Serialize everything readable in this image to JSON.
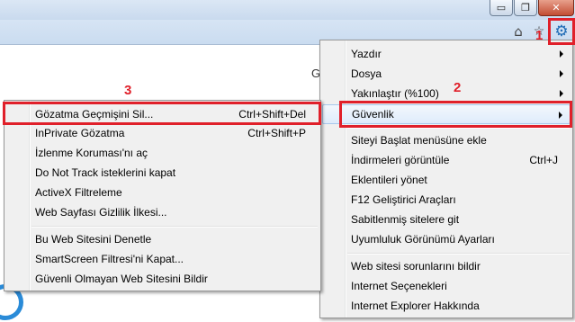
{
  "window": {
    "minimize_glyph": "▭",
    "restore_glyph": "❐",
    "close_glyph": "✕"
  },
  "toolbar": {
    "home_icon": "⌂",
    "favorites_icon": "☆",
    "tools_icon": "⚙"
  },
  "page": {
    "partial_text": "G"
  },
  "annotations": {
    "step1": "1",
    "step2": "2",
    "step3": "3",
    "color": "#e0202a"
  },
  "tools_menu": {
    "items": [
      {
        "label": "Yazdır",
        "shortcut": "",
        "submenu": true
      },
      {
        "label": "Dosya",
        "shortcut": "",
        "submenu": true
      },
      {
        "label": "Yakınlaştır (%100)",
        "shortcut": "",
        "submenu": true
      },
      {
        "label": "Güvenlik",
        "shortcut": "",
        "submenu": true
      },
      {
        "label": "Siteyi Başlat menüsüne ekle",
        "shortcut": "",
        "submenu": false
      },
      {
        "label": "İndirmeleri görüntüle",
        "shortcut": "Ctrl+J",
        "submenu": false
      },
      {
        "label": "Eklentileri yönet",
        "shortcut": "",
        "submenu": false
      },
      {
        "label": "F12 Geliştirici Araçları",
        "shortcut": "",
        "submenu": false
      },
      {
        "label": "Sabitlenmiş sitelere git",
        "shortcut": "",
        "submenu": false
      },
      {
        "label": "Uyumluluk Görünümü Ayarları",
        "shortcut": "",
        "submenu": false
      },
      {
        "label": "Web sitesi sorunlarını bildir",
        "shortcut": "",
        "submenu": false
      },
      {
        "label": "Internet Seçenekleri",
        "shortcut": "",
        "submenu": false
      },
      {
        "label": "Internet Explorer Hakkında",
        "shortcut": "",
        "submenu": false
      }
    ]
  },
  "security_menu": {
    "items": [
      {
        "label": "Gözatma Geçmişini Sil...",
        "shortcut": "Ctrl+Shift+Del"
      },
      {
        "label": "InPrivate Gözatma",
        "shortcut": "Ctrl+Shift+P"
      },
      {
        "label": "İzlenme Koruması'nı aç",
        "shortcut": ""
      },
      {
        "label": "Do Not Track isteklerini kapat",
        "shortcut": ""
      },
      {
        "label": "ActiveX Filtreleme",
        "shortcut": ""
      },
      {
        "label": "Web Sayfası Gizlilik İlkesi...",
        "shortcut": ""
      },
      {
        "label": "Bu Web Sitesini Denetle",
        "shortcut": ""
      },
      {
        "label": "SmartScreen Filtresi'ni Kapat...",
        "shortcut": ""
      },
      {
        "label": "Güvenli Olmayan Web Sitesini Bildir",
        "shortcut": ""
      }
    ]
  }
}
